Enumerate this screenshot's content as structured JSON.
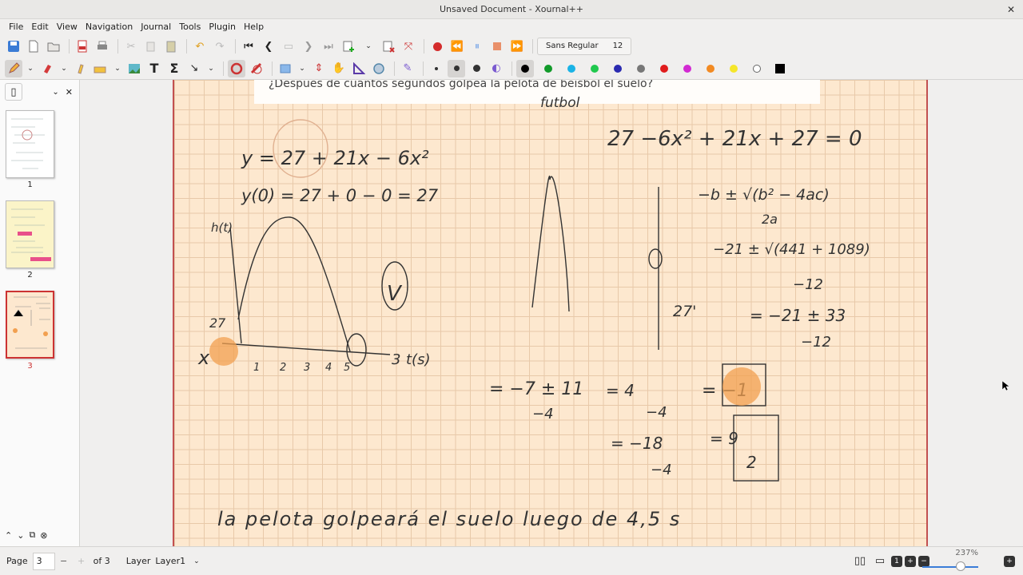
{
  "window": {
    "title": "Unsaved Document - Xournal++",
    "close_glyph": "✕"
  },
  "menu": [
    "File",
    "Edit",
    "View",
    "Navigation",
    "Journal",
    "Tools",
    "Plugin",
    "Help"
  ],
  "font": {
    "name": "Sans Regular",
    "size": "12"
  },
  "palette": [
    "#000000",
    "#119a2a",
    "#1ab3e6",
    "#20c84e",
    "#2a2ab0",
    "#777777",
    "#e01c1c",
    "#d22ad2",
    "#f28a22",
    "#f5e62a",
    "#ffffff"
  ],
  "sidebar": {
    "pages": [
      "1",
      "2",
      "3"
    ],
    "selected_page": 3
  },
  "document": {
    "question": "¿Después de cuántos segundos golpea la pelota de béisbol el suelo?",
    "handwriting": {
      "futbol": "futbol",
      "eq1": "y = 27 + 21x − 6x²",
      "eq2": "y(0) = 27 + 0 − 0 = 27",
      "axis_h": "h(t)",
      "axis_t": "t(s)",
      "label_27": "27",
      "label_x": "x",
      "ticks": [
        "1",
        "2",
        "3",
        "4",
        "5"
      ],
      "label_3": "3",
      "label_v": "V",
      "quad_eq": "27 −6x² + 21x + 27 = 0",
      "formula": "−b ± √(b² − 4ac)",
      "formula_den": "2a",
      "step1_num": "−21 ± √(441 + 1089)",
      "step1_den": "−12",
      "step2": "= −21 ± 33",
      "step2_den": "−12",
      "label_27p": "27'",
      "step3_num": "= −7 ± 11",
      "step3_den": "−4",
      "step4_num": "= 4",
      "step4_den": "−4",
      "step4_res": "= −1",
      "step5_num": "= −18",
      "step5_den": "−4",
      "step5_res": "= 9",
      "step5_res_den": "2",
      "conclusion": "la pelota golpeará el suelo luego de 4,5 s"
    }
  },
  "status": {
    "page_label": "Page",
    "page": "3",
    "of_label": "of 3",
    "layer_label": "Layer",
    "layer": "Layer1",
    "zoom": "237%"
  }
}
